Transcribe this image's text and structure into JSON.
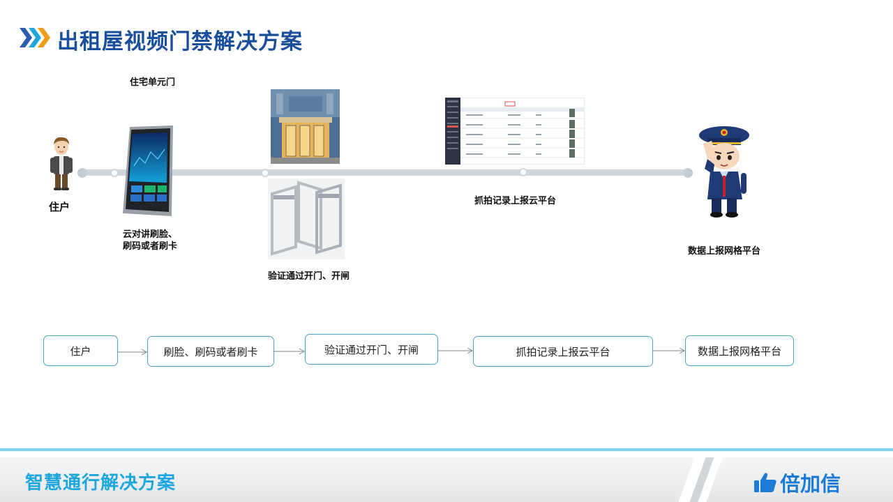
{
  "header": {
    "title": "出租屋视频门禁解决方案"
  },
  "diagram": {
    "resident_label": "住户",
    "unit_door_label": "住宅单元门",
    "intercom_label_line1": "云对讲刷脸、",
    "intercom_label_line2": "刷码或者刷卡",
    "verify_label": "验证通过开门、开闸",
    "cloud_label": "抓拍记录上报云平台",
    "grid_label": "数据上报网格平台"
  },
  "flow": {
    "steps": [
      "住户",
      "刷脸、刷码或者刷卡",
      "验证通过开门、开闸",
      "抓拍记录上报云平台",
      "数据上报网格平台"
    ]
  },
  "footer": {
    "title": "智慧通行解决方案",
    "brand": "倍加信"
  },
  "colors": {
    "title": "#1a4f9c",
    "footer_title": "#1fa6dc",
    "brand": "#1b7bd6",
    "box_border": "#4aa3c9",
    "timeline": "#cfd6de"
  }
}
